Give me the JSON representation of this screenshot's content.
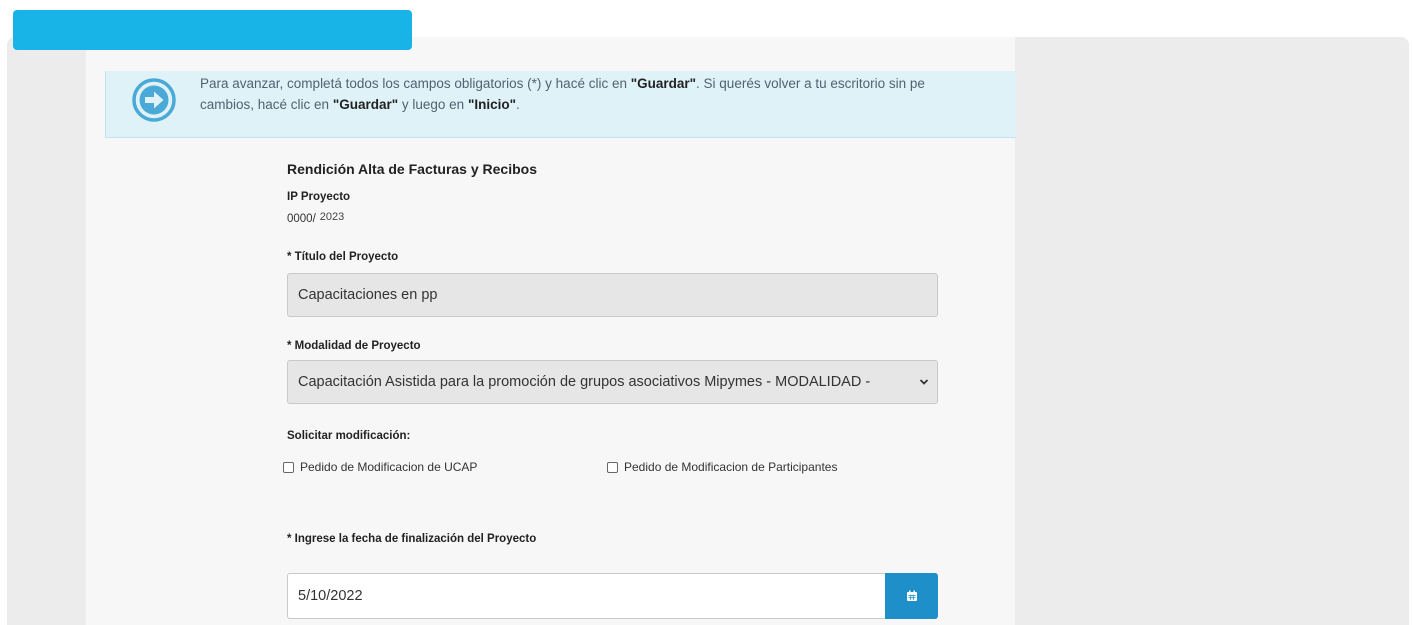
{
  "notice": {
    "line1_before": "Para avanzar, completá todos los campos obligatorios (*) y hacé clic en ",
    "line1_bold": "\"Guardar\"",
    "line1_after": ". Si querés volver a tu escritorio sin pe",
    "line2_before": "cambios, hacé clic en ",
    "line2_bold1": "\"Guardar\"",
    "line2_mid": " y luego en ",
    "line2_bold2": "\"Inicio\"",
    "line2_after": "."
  },
  "form": {
    "section_title": "Rendición Alta de Facturas y Recibos",
    "ip_label": "IP Proyecto",
    "ip_prefix": "0000/",
    "ip_year": "2023",
    "titulo_label": "* Título del Proyecto",
    "titulo_value": "Capacitaciones en pp",
    "modalidad_label": "* Modalidad de Proyecto",
    "modalidad_value": "Capacitación Asistida para la promoción de grupos asociativos Mipymes - MODALIDAD -",
    "solicitar_label": "Solicitar modificación:",
    "check_ucap": "Pedido de Modificacion de UCAP",
    "check_participantes": "Pedido de Modificacion de Participantes",
    "fecha_label": "* Ingrese la fecha de finalización del Proyecto",
    "fecha_value": "5/10/2022"
  },
  "icons": {
    "notice": "arrow-right-circle-icon",
    "calendar": "calendar-icon",
    "dropdown": "chevron-down-icon"
  },
  "colors": {
    "top_tab": "#18b4e8",
    "notice_bg": "#dff2f8",
    "notice_icon": "#4aa9d6",
    "calendar_button": "#1f8fc9"
  }
}
